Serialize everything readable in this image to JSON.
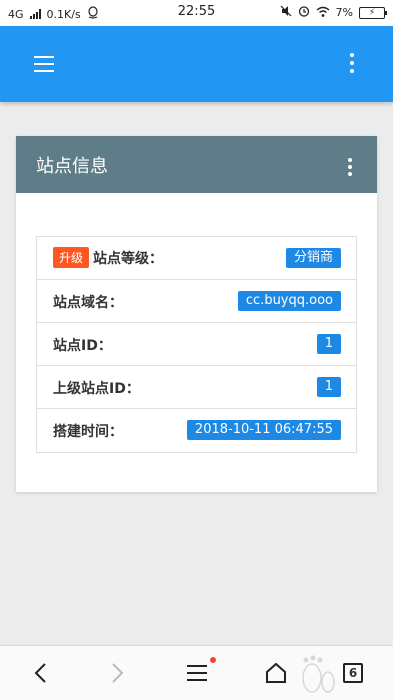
{
  "status_bar": {
    "network": "4G",
    "speed": "0.1K/s",
    "time": "22:55",
    "battery": "7%"
  },
  "card": {
    "title": "站点信息",
    "rows": [
      {
        "tag": "升级",
        "label": "站点等级：",
        "value": "分销商"
      },
      {
        "label": "站点域名：",
        "value": "cc.buyqq.ooo"
      },
      {
        "label": "站点ID：",
        "value": "1"
      },
      {
        "label": "上级站点ID：",
        "value": "1"
      },
      {
        "label": "搭建时间：",
        "value": "2018-10-11 06:47:55"
      }
    ]
  },
  "bottom_nav": {
    "tab_count": "6"
  },
  "colors": {
    "app_bar": "#2196f3",
    "card_header": "#5f7d88",
    "badge": "#1e88e5",
    "upgrade_tag": "#ff5722"
  }
}
